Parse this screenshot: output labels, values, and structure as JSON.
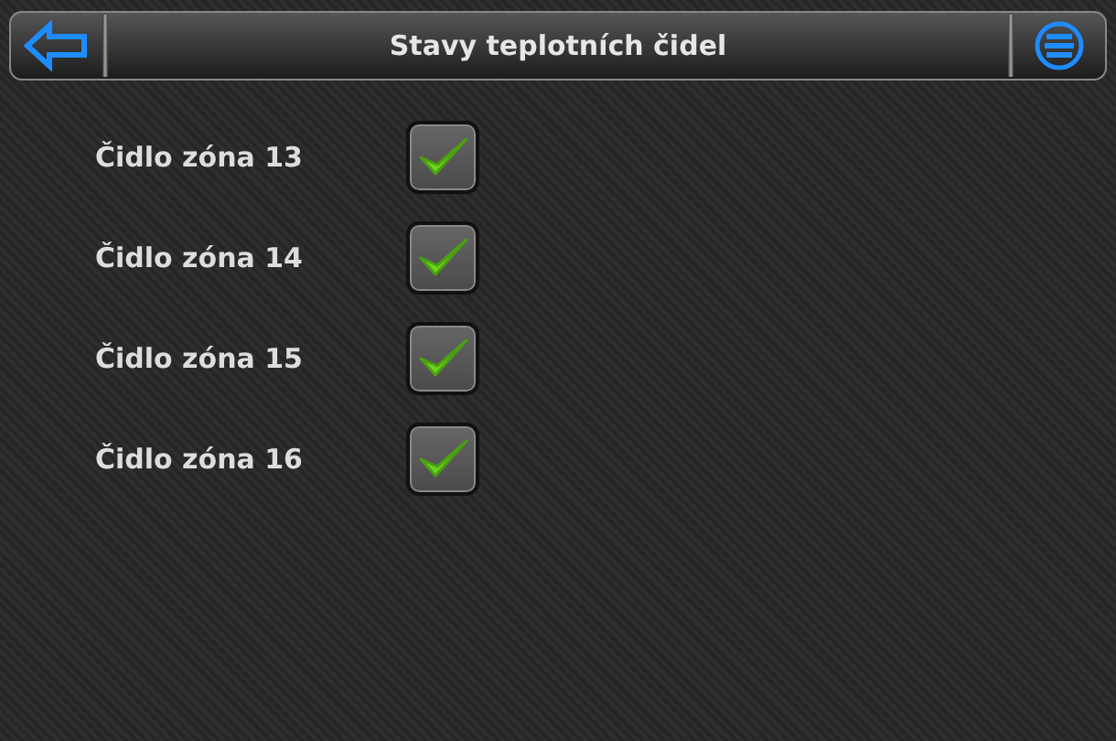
{
  "header": {
    "title": "Stavy teplotních čidel"
  },
  "sensors": [
    {
      "label": "Čidlo zóna 13",
      "checked": true
    },
    {
      "label": "Čidlo zóna 14",
      "checked": true
    },
    {
      "label": "Čidlo zóna 15",
      "checked": true
    },
    {
      "label": "Čidlo zóna 16",
      "checked": true
    }
  ]
}
